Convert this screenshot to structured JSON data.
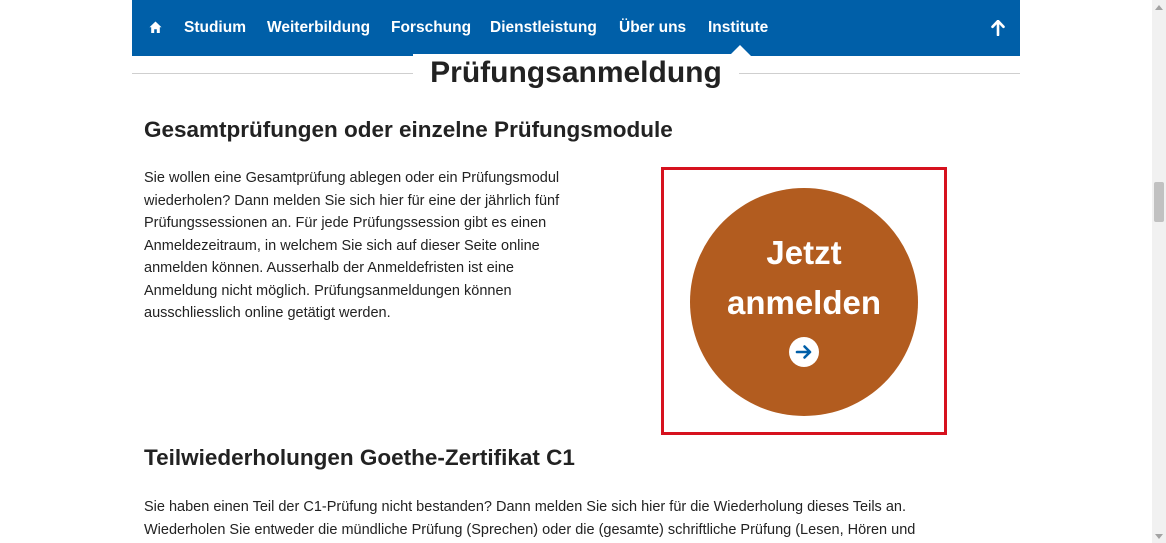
{
  "nav": {
    "home_icon": "home-icon",
    "items": [
      {
        "label": "Studium"
      },
      {
        "label": "Weiterbildung"
      },
      {
        "label": "Forschung"
      },
      {
        "label": "Dienstleistung"
      },
      {
        "label": "Über uns"
      },
      {
        "label": "Institute"
      }
    ],
    "active_item": "Institute",
    "up_icon": "arrow-up-icon",
    "background_color": "#005fa8"
  },
  "page": {
    "title": "Prüfungsanmeldung"
  },
  "section1": {
    "heading": "Gesamtprüfungen oder einzelne Prüfungsmodule",
    "lines": [
      "Sie wollen eine Gesamtprüfung ablegen oder ein Prüfungsmodul",
      "wiederholen? Dann melden Sie sich hier für eine der jährlich fünf",
      "Prüfungssessionen an. Für jede Prüfungssession gibt es einen",
      "Anmeldezeitraum, in welchem Sie sich auf dieser Seite online",
      "anmelden können. Ausserhalb der Anmeldefristen ist eine",
      "Anmeldung nicht möglich. Prüfungsanmeldungen können",
      "ausschliesslich online getätigt werden."
    ]
  },
  "cta": {
    "line1": "Jetzt",
    "line2": "anmelden",
    "icon": "arrow-right-circle-icon",
    "color": "#b25c1f",
    "highlight_color": "#d6111e"
  },
  "section2": {
    "heading": "Teilwiederholungen Goethe-Zertifikat C1",
    "lines": [
      "Sie haben einen Teil der C1-Prüfung nicht bestanden? Dann melden Sie sich hier für die Wiederholung dieses Teils an.",
      "Wiederholen Sie entweder die mündliche Prüfung (Sprechen) oder die (gesamte) schriftliche Prüfung (Lesen, Hören und"
    ]
  }
}
